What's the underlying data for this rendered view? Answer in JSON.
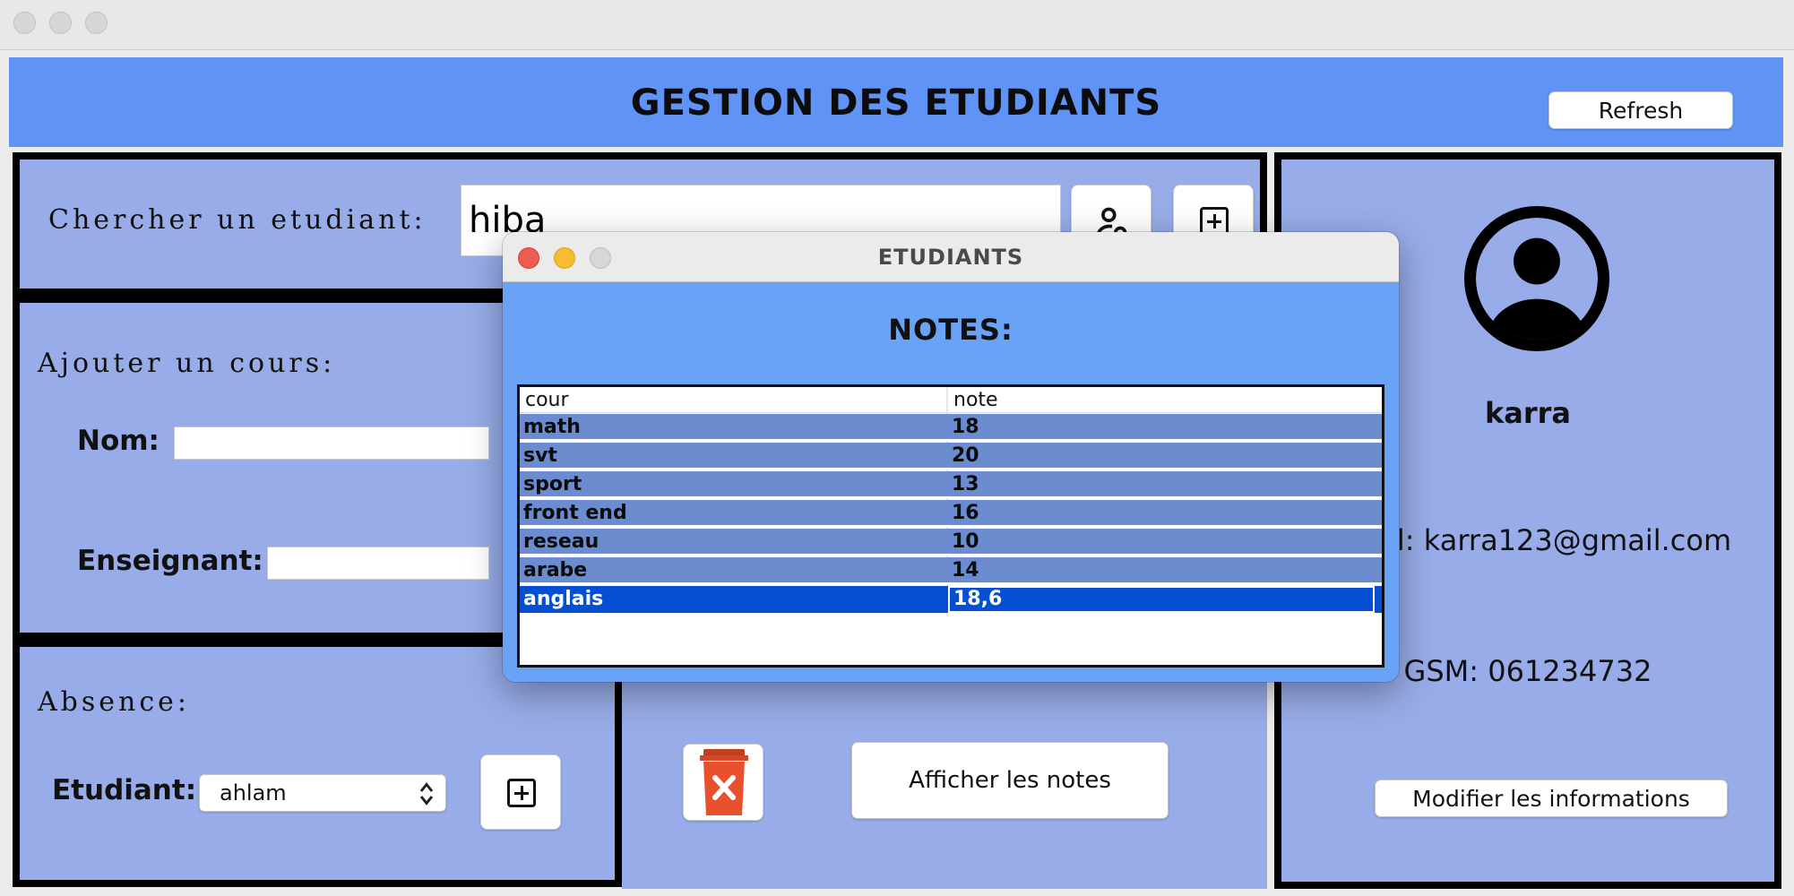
{
  "app": {
    "title": "GESTION DES ETUDIANTS",
    "refresh_label": "Refresh"
  },
  "search": {
    "label": "Chercher un etudiant:",
    "value": "hiba"
  },
  "course": {
    "label": "Ajouter un cours:",
    "name_label": "Nom:",
    "name_value": "",
    "teacher_label": "Enseignant:",
    "teacher_value": ""
  },
  "absence": {
    "label": "Absence:",
    "student_label": "Etudiant:",
    "student_selected": "ahlam"
  },
  "center": {
    "show_notes_label": "Afficher les notes"
  },
  "profile": {
    "name": "karra",
    "email_text": "il: karra123@gmail.com",
    "gsm_text": "GSM: 061234732",
    "modify_label": "Modifier les informations"
  },
  "dialog": {
    "window_title": "ETUDIANTS",
    "heading": "NOTES:",
    "columns": [
      "cour",
      "note"
    ],
    "rows": [
      [
        "math",
        "18"
      ],
      [
        "svt",
        "20"
      ],
      [
        "sport",
        "13"
      ],
      [
        "front end",
        "16"
      ],
      [
        "reseau",
        "10"
      ],
      [
        "arabe",
        "14"
      ],
      [
        "anglais",
        "18,6"
      ]
    ],
    "selected_row": 6
  },
  "colors": {
    "header_blue": "#5f93f6",
    "panel_blue": "#97ace8",
    "dialog_blue": "#6aa3f6",
    "row_blue": "#6b8dcf",
    "selected_blue": "#0550d2",
    "delete_red": "#e8502e"
  },
  "icons": {
    "person_search": "user-search-icon",
    "add": "plus-square-icon",
    "delete": "trash-icon",
    "avatar": "user-circle-icon"
  }
}
